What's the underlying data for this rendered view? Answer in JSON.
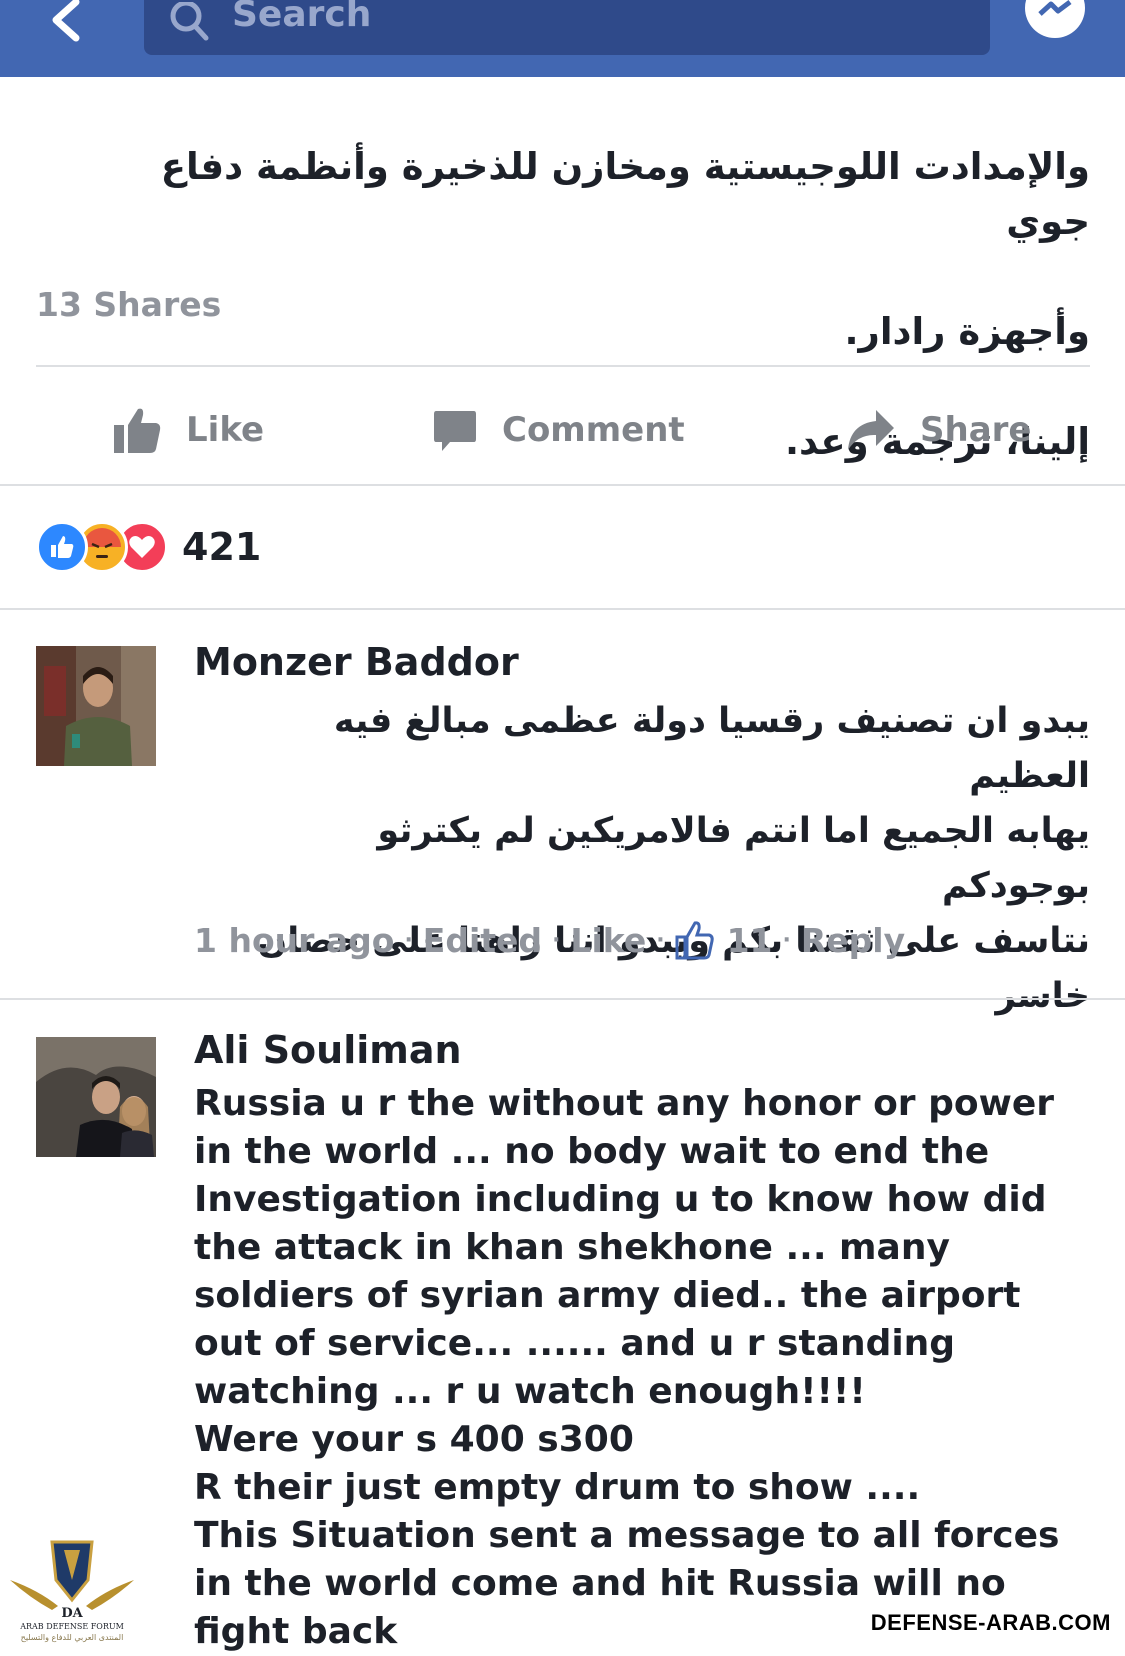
{
  "topbar": {
    "search_placeholder": "Search",
    "bg_color": "#4267b2"
  },
  "post": {
    "text_lines": [
      "والإمدادت اللوجيستية ومخازن للذخيرة وأنظمة دفاع جوي",
      "وأجهزة رادار.",
      "إلينا، ترجمة وعد."
    ],
    "shares_label": "13 Shares"
  },
  "actions": {
    "like": "Like",
    "comment": "Comment",
    "share": "Share"
  },
  "reactions": {
    "count": "421",
    "icons": [
      "like-icon",
      "angry-icon",
      "love-icon"
    ]
  },
  "comments": [
    {
      "name": "Monzer Baddor",
      "body_lines": [
        "يبدو ان تصنيف رقسيا دولة عظمى مبالغ فيه العظيم",
        "يهابه الجميع اما انتم فالامريكين لم يكترثو بوجودكم",
        "نتاسف على ثقتنا بكم ويبدو اننا راهنا على حصان",
        "خاسر"
      ],
      "time": "1 hour ago",
      "edited": "Edited",
      "like": "Like",
      "like_count": "11",
      "reply": "Reply"
    },
    {
      "name": "Ali Souliman",
      "body_lines": [
        "Russia u r the without  any honor or power",
        "in the world ...  no body wait to end the",
        "Investigation including u to know how  did",
        "the attack  in khan shekhone ... many",
        "soldiers of syrian army died.. the airport",
        "out of service... ...... and u r standing",
        "watching ... r u watch enough!!!!",
        "Were your s 400 s300",
        "R their  just empty drum  to show ....",
        "This Situation sent a message  to all forces",
        "in the world  come and hit Russia  will no",
        "fight back"
      ]
    }
  ],
  "watermark": {
    "site": "DEFENSE-ARAB.COM",
    "logo_line1": "ARAB DEFENSE FORUM",
    "logo_line2": "المنتدى العربي للدفاع والتسليح",
    "logo_initials": "DA"
  }
}
